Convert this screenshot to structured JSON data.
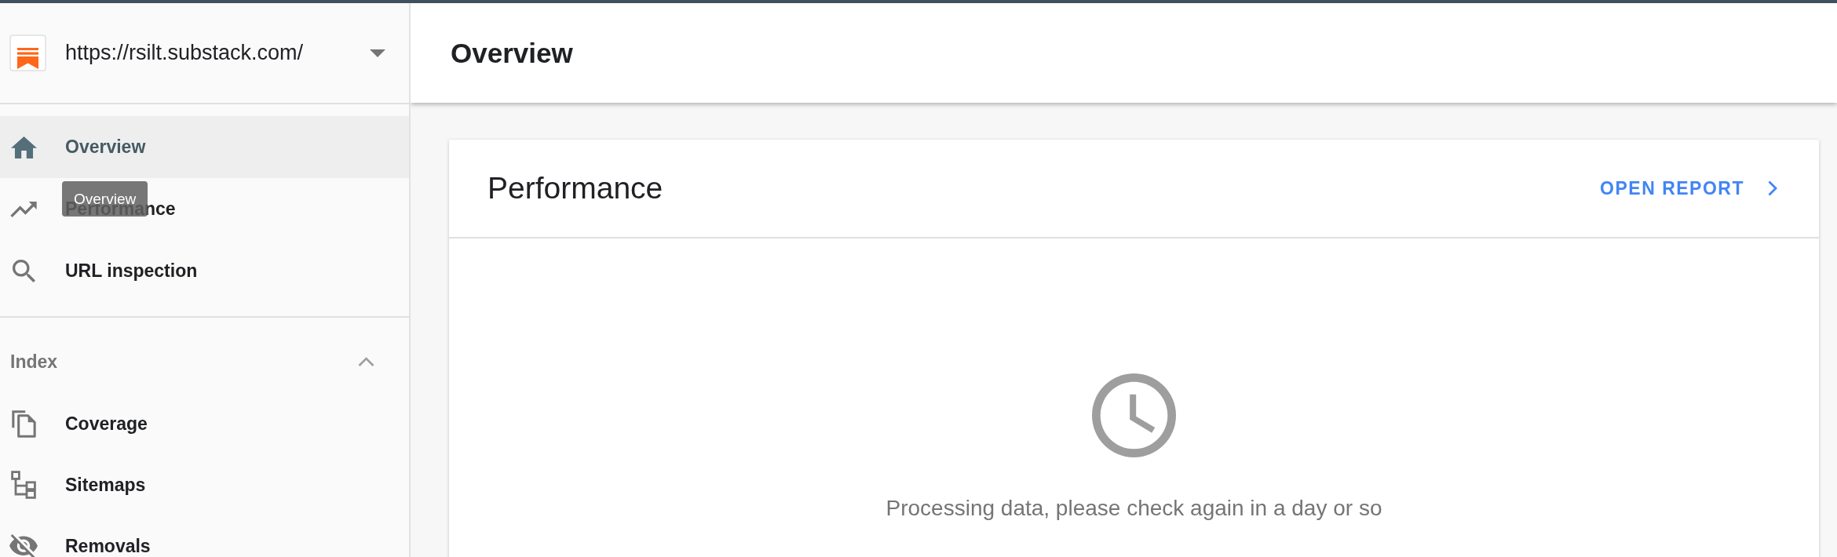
{
  "property_selector": {
    "url": "https://rsilt.substack.com/"
  },
  "sidebar": {
    "items": [
      {
        "label": "Overview",
        "selected": true
      },
      {
        "label": "Performance",
        "selected": false
      },
      {
        "label": "URL inspection",
        "selected": false
      }
    ],
    "sections": [
      {
        "title": "Index",
        "expanded": true,
        "items": [
          {
            "label": "Coverage",
            "selected": false
          },
          {
            "label": "Sitemaps",
            "selected": false
          },
          {
            "label": "Removals",
            "selected": false
          }
        ]
      }
    ]
  },
  "tooltip": {
    "text": "Overview"
  },
  "page_header": {
    "title": "Overview"
  },
  "cards": [
    {
      "title": "Performance",
      "action": "OPEN REPORT",
      "message": "Processing data, please check again in a day or so"
    }
  ]
}
